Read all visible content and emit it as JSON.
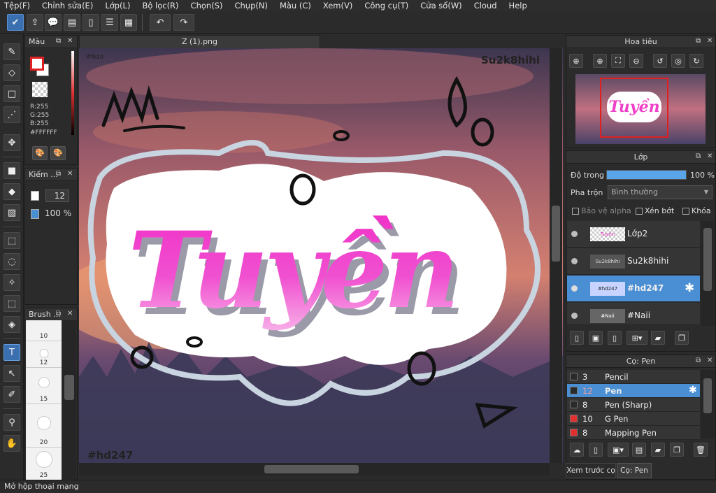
{
  "menu": [
    "Tệp(F)",
    "Chỉnh sửa(E)",
    "Lớp(L)",
    "Bộ lọc(R)",
    "Chọn(S)",
    "Chụp(N)",
    "Màu (C)",
    "Xem(V)",
    "Công cụ(T)",
    "Cửa sổ(W)",
    "Cloud",
    "Help"
  ],
  "canvas": {
    "tab_title": "Z (1).png",
    "tag_top_left": "#Naii",
    "tag_top_right": "Su2k8hihi",
    "tag_bottom_left": "#hd247",
    "title_text": "Tuyền"
  },
  "color_panel": {
    "title": "Màu",
    "r": "R:255",
    "g": "G:255",
    "b": "B:255",
    "hex": "#FFFFFF"
  },
  "brush_ctrl_panel": {
    "title": "Kiếm ...",
    "size": "12",
    "opacity": "100 %"
  },
  "brush_size_panel": {
    "title": "Brush ...",
    "sizes": [
      "10",
      "12",
      "15",
      "20",
      "25"
    ]
  },
  "navigator": {
    "title": "Hoa tiêu"
  },
  "layers": {
    "title": "Lớp",
    "opacity_label": "Độ trong",
    "opacity_value": "100 %",
    "opacity_fraction": 1.0,
    "blend_label": "Pha trộn",
    "blend_value": "Bình thường",
    "protect_alpha": "Bảo vệ alpha",
    "clipping": "Xén bớt",
    "lock": "Khóa",
    "items": [
      {
        "name": "Lớp2",
        "thumb": "Tuyền"
      },
      {
        "name": "Su2k8hihi",
        "thumb": "Su2k8hihi"
      },
      {
        "name": "#hd247",
        "thumb": "#hd247"
      },
      {
        "name": "#Naii",
        "thumb": "#Naii"
      }
    ]
  },
  "brush_panel": {
    "title": "Cọ: Pen",
    "items": [
      {
        "size": "3",
        "name": "Pencil",
        "color": "#2a2a2a"
      },
      {
        "size": "12",
        "name": "Pen",
        "color": "#2a2a2a"
      },
      {
        "size": "8",
        "name": "Pen (Sharp)",
        "color": "#2a2a2a"
      },
      {
        "size": "10",
        "name": "G Pen",
        "color": "#e03030"
      },
      {
        "size": "8",
        "name": "Mapping Pen",
        "color": "#e03030"
      }
    ],
    "tab_preview": "Xem trước cọ",
    "tab_brush": "Cọ: Pen"
  },
  "status": "Mở hộp thoại mạng"
}
